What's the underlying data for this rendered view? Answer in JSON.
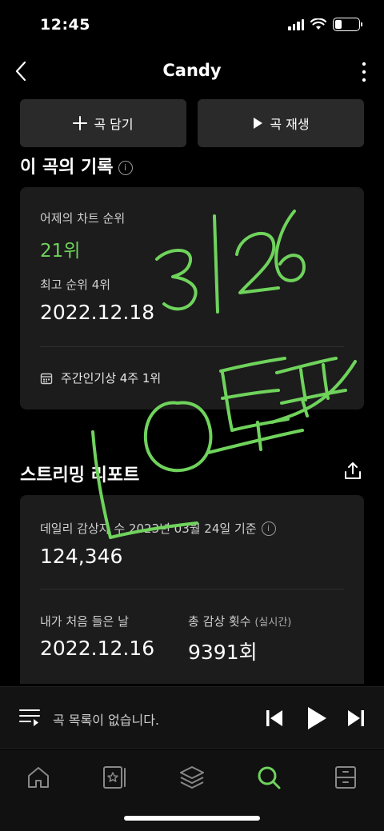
{
  "status_bar": {
    "time": "12:45"
  },
  "nav": {
    "title": "Candy"
  },
  "actions": {
    "add_label": "곡 담기",
    "play_label": "곡 재생"
  },
  "record": {
    "section_title": "이 곡의 기록",
    "yesterday_label": "어제의 차트 순위",
    "yesterday_rank": "21위",
    "best_label": "최고 순위 4위",
    "best_date": "2022.12.18",
    "weekly_label": "주간인기상 4주 1위"
  },
  "streaming": {
    "section_title": "스트리밍 리포트",
    "daily_label": "데일리 감상자 수 2023년 03월 24일 기준",
    "daily_value": "124,346",
    "first_listen_label": "내가 처음 들은 날",
    "first_listen_date": "2022.12.16",
    "total_plays_label": "총 감상 횟수",
    "total_plays_suffix": "(실시간)",
    "total_plays_value": "9391회"
  },
  "mini_player": {
    "queue_text": "곡 목록이 없습니다."
  },
  "colors": {
    "accent": "#6fd35c",
    "background": "#000000",
    "card": "#1c1c1c",
    "button": "#2a2a2a"
  },
  "icons": [
    "back-icon",
    "more-icon",
    "plus-icon",
    "play-icon",
    "info-icon",
    "calendar-icon",
    "share-icon",
    "queue-icon",
    "previous-icon",
    "next-icon",
    "home-icon",
    "library-icon",
    "layers-icon",
    "search-icon",
    "storage-icon"
  ],
  "handwriting": "3126 LO트포"
}
